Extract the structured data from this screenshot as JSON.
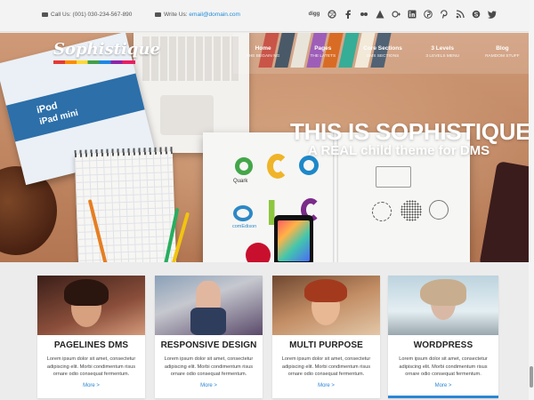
{
  "topbar": {
    "phone_label": "Call Us: (001) 030-234-567-890",
    "write_prefix": "Write Us: ",
    "email": "email@domain.com",
    "social_icons": [
      "digg-icon",
      "dribbble-icon",
      "facebook-icon",
      "flickr-icon",
      "forrst-icon",
      "google-plus-icon",
      "linkedin-icon",
      "pinterest-alt-icon",
      "pinterest-icon",
      "rss-icon",
      "skype-icon",
      "twitter-icon"
    ],
    "digg_text": "digg"
  },
  "brand": {
    "name": "Sophistique"
  },
  "nav": [
    {
      "label": "Home",
      "sub": "THE BEGAIN NG"
    },
    {
      "label": "Pages",
      "sub": "THE LATETS"
    },
    {
      "label": "Core Sections",
      "sub": "DMS SECTIONS"
    },
    {
      "label": "3 Levels",
      "sub": "3 LEVELS MENU"
    },
    {
      "label": "Blog",
      "sub": "RAMDOM STUFF"
    }
  ],
  "hero": {
    "title": "THIS IS SOPHISTIQUE",
    "subtitle": "A REAL child theme for DMS",
    "ipad_text1": "iPod",
    "ipad_text2": "iPad mini",
    "quark": "Quark",
    "combo": "comEdison"
  },
  "cards": [
    {
      "title": "PAGELINES DMS",
      "body": "Lorem ipsum dolor sit amet, consectetur adipiscing elit. Morbi condimentum risus ornare odio consequat fermentum.",
      "more": "More >"
    },
    {
      "title": "RESPONSIVE DESIGN",
      "body": "Lorem ipsum dolor sit amet, consectetur adipiscing elit. Morbi condimentum risus ornare odio consequat fermentum.",
      "more": "More >"
    },
    {
      "title": "MULTI PURPOSE",
      "body": "Lorem ipsum dolor sit amet, consectetur adipiscing elit. Morbi condimentum risus ornare odio consequat fermentum.",
      "more": "More >"
    },
    {
      "title": "WORDPRESS",
      "body": "Lorem ipsum dolor sit amet, consectetur adipiscing elit. Morbi condimentum risus ornare odio consequat fermentum.",
      "more": "More >"
    }
  ],
  "colors": {
    "accent": "#2c86d4",
    "topbar_bg": "#f3f3f3",
    "page_bg": "#ececec"
  }
}
